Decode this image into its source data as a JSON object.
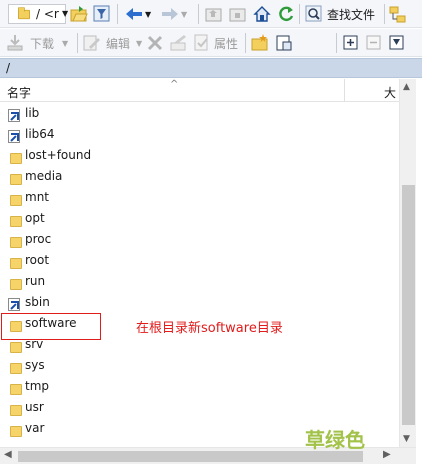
{
  "toolbar1": {
    "path": "/ <r",
    "search_label": "查找文件"
  },
  "toolbar2": {
    "download_label": "下载",
    "edit_label": "编辑",
    "properties_label": "属性"
  },
  "location": {
    "path": "/"
  },
  "columns": {
    "name": "名字",
    "size": "大"
  },
  "files": [
    {
      "name": "lib",
      "type": "link"
    },
    {
      "name": "lib64",
      "type": "link"
    },
    {
      "name": "lost+found",
      "type": "folder"
    },
    {
      "name": "media",
      "type": "folder"
    },
    {
      "name": "mnt",
      "type": "folder"
    },
    {
      "name": "opt",
      "type": "folder"
    },
    {
      "name": "proc",
      "type": "folder"
    },
    {
      "name": "root",
      "type": "folder"
    },
    {
      "name": "run",
      "type": "folder"
    },
    {
      "name": "sbin",
      "type": "link"
    },
    {
      "name": "software",
      "type": "folder"
    },
    {
      "name": "srv",
      "type": "folder"
    },
    {
      "name": "sys",
      "type": "folder"
    },
    {
      "name": "tmp",
      "type": "folder"
    },
    {
      "name": "usr",
      "type": "folder"
    },
    {
      "name": "var",
      "type": "folder"
    }
  ],
  "annotation": {
    "text": "在根目录新software目录",
    "color": "#e21b1b"
  },
  "watermark": {
    "text": "草绿色",
    "color": "#a2c24a"
  }
}
